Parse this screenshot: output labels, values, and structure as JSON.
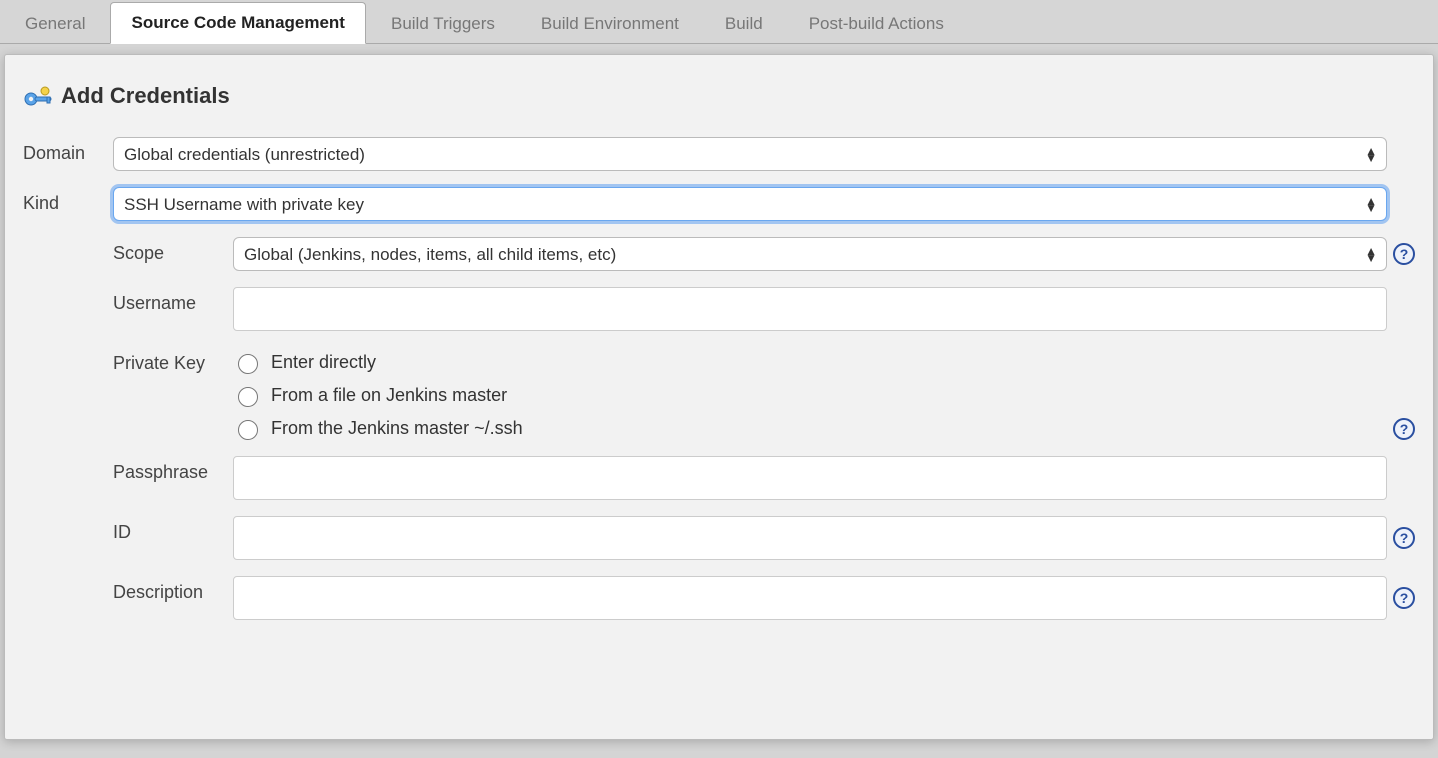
{
  "tabs": {
    "items": [
      {
        "label": "General",
        "active": false
      },
      {
        "label": "Source Code Management",
        "active": true
      },
      {
        "label": "Build Triggers",
        "active": false
      },
      {
        "label": "Build Environment",
        "active": false
      },
      {
        "label": "Build",
        "active": false
      },
      {
        "label": "Post-build Actions",
        "active": false
      }
    ]
  },
  "modal": {
    "title": "Add Credentials",
    "domain": {
      "label": "Domain",
      "value": "Global credentials (unrestricted)"
    },
    "kind": {
      "label": "Kind",
      "value": "SSH Username with private key"
    },
    "scope": {
      "label": "Scope",
      "value": "Global (Jenkins, nodes, items, all child items, etc)"
    },
    "username": {
      "label": "Username",
      "value": ""
    },
    "privateKey": {
      "label": "Private Key",
      "options": [
        "Enter directly",
        "From a file on Jenkins master",
        "From the Jenkins master ~/.ssh"
      ]
    },
    "passphrase": {
      "label": "Passphrase",
      "value": ""
    },
    "id": {
      "label": "ID",
      "value": ""
    },
    "description": {
      "label": "Description",
      "value": ""
    },
    "helpGlyph": "?"
  }
}
